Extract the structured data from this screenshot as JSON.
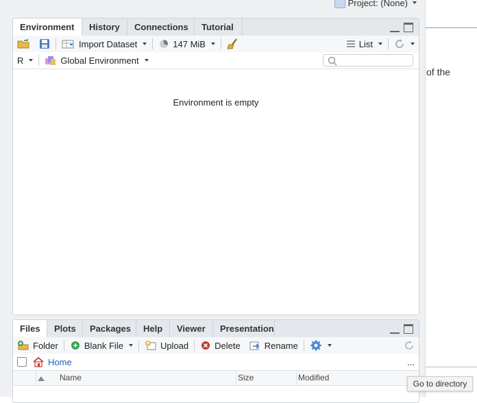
{
  "topbar": {
    "project_label": "Project: (None)"
  },
  "background_panel": {
    "partial_text": "of the"
  },
  "env_pane": {
    "tabs": [
      "Environment",
      "History",
      "Connections",
      "Tutorial"
    ],
    "toolbar": {
      "import_label": "Import Dataset",
      "memory_label": "147 MiB",
      "list_label": "List"
    },
    "subtoolbar": {
      "language_label": "R",
      "env_label": "Global Environment",
      "search_placeholder": ""
    },
    "empty_message": "Environment is empty"
  },
  "files_pane": {
    "tabs": [
      "Files",
      "Plots",
      "Packages",
      "Help",
      "Viewer",
      "Presentation"
    ],
    "toolbar": {
      "folder_label": "Folder",
      "blank_file_label": "Blank File",
      "upload_label": "Upload",
      "delete_label": "Delete",
      "rename_label": "Rename"
    },
    "path": {
      "home_label": "Home",
      "more_label": "..."
    },
    "columns": [
      "Name",
      "Size",
      "Modified"
    ]
  },
  "tooltip": {
    "text": "Go to directory"
  },
  "colors": {
    "link": "#1b63b7",
    "tab_bg": "#e4e8ec",
    "pane_bg": "#ffffff",
    "window_bg": "#eef0f2"
  }
}
